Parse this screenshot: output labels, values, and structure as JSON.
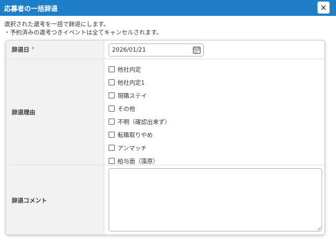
{
  "dialog": {
    "title": "応募者の一括辞退",
    "close_label": "×"
  },
  "intro": {
    "line1": "選択された選考を一括で辞退にします。",
    "line2": "・予約済みの選考つきイベントは全てキャンセルされます。"
  },
  "form": {
    "date": {
      "label": "辞退日",
      "required_mark": "*",
      "value": "2026/01/21",
      "icon": "calendar-icon"
    },
    "reason": {
      "label": "辞退理由",
      "options": [
        {
          "label": "他社内定",
          "checked": false
        },
        {
          "label": "他社内定1",
          "checked": false
        },
        {
          "label": "現職ステイ",
          "checked": false
        },
        {
          "label": "その他",
          "checked": false
        },
        {
          "label": "不明（確認出来ず）",
          "checked": false
        },
        {
          "label": "転職取りやめ",
          "checked": false
        },
        {
          "label": "アンマッチ",
          "checked": false
        },
        {
          "label": "給与面（藻原）",
          "checked": false
        }
      ]
    },
    "comment": {
      "label": "辞退コメント",
      "value": ""
    }
  },
  "colors": {
    "titlebar": "#1e7ec8",
    "label_bg": "#f2f2f2",
    "required": "#d9534f"
  }
}
